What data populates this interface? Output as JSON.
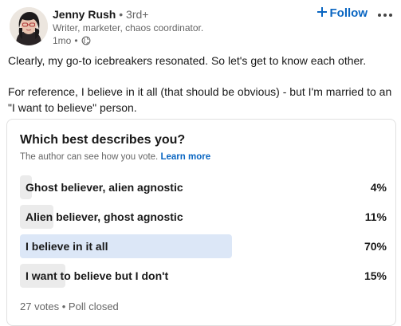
{
  "author": {
    "name": "Jenny Rush",
    "degree": "3rd+",
    "headline": "Writer, marketer, chaos coordinator.",
    "time": "1mo"
  },
  "actions": {
    "follow_label": "Follow"
  },
  "icons": {
    "plus": "plus-icon",
    "globe": "globe-icon",
    "more": "more-icon"
  },
  "post": {
    "line1": "Clearly, my go-to icebreakers resonated. So let's get to know each other.",
    "line2": "For reference, I believe in it all (that should be obvious) - but I'm married to an \"I want to believe\" person."
  },
  "poll": {
    "question": "Which best describes you?",
    "visibility_note": "The author can see how you vote.",
    "learn_more": "Learn more",
    "options": [
      {
        "label": "Ghost believer, alien agnostic",
        "percent": "4%",
        "value": 4,
        "selected": false
      },
      {
        "label": "Alien believer, ghost agnostic",
        "percent": "11%",
        "value": 11,
        "selected": false
      },
      {
        "label": "I believe in it all",
        "percent": "70%",
        "value": 70,
        "selected": true
      },
      {
        "label": "I want to believe but I don't",
        "percent": "15%",
        "value": 15,
        "selected": false
      }
    ],
    "footer": "27 votes • Poll closed"
  },
  "colors": {
    "accent": "#0a66c2",
    "bar": "#ebebeb",
    "bar_selected": "#dce7f7",
    "muted_text": "#666666"
  }
}
